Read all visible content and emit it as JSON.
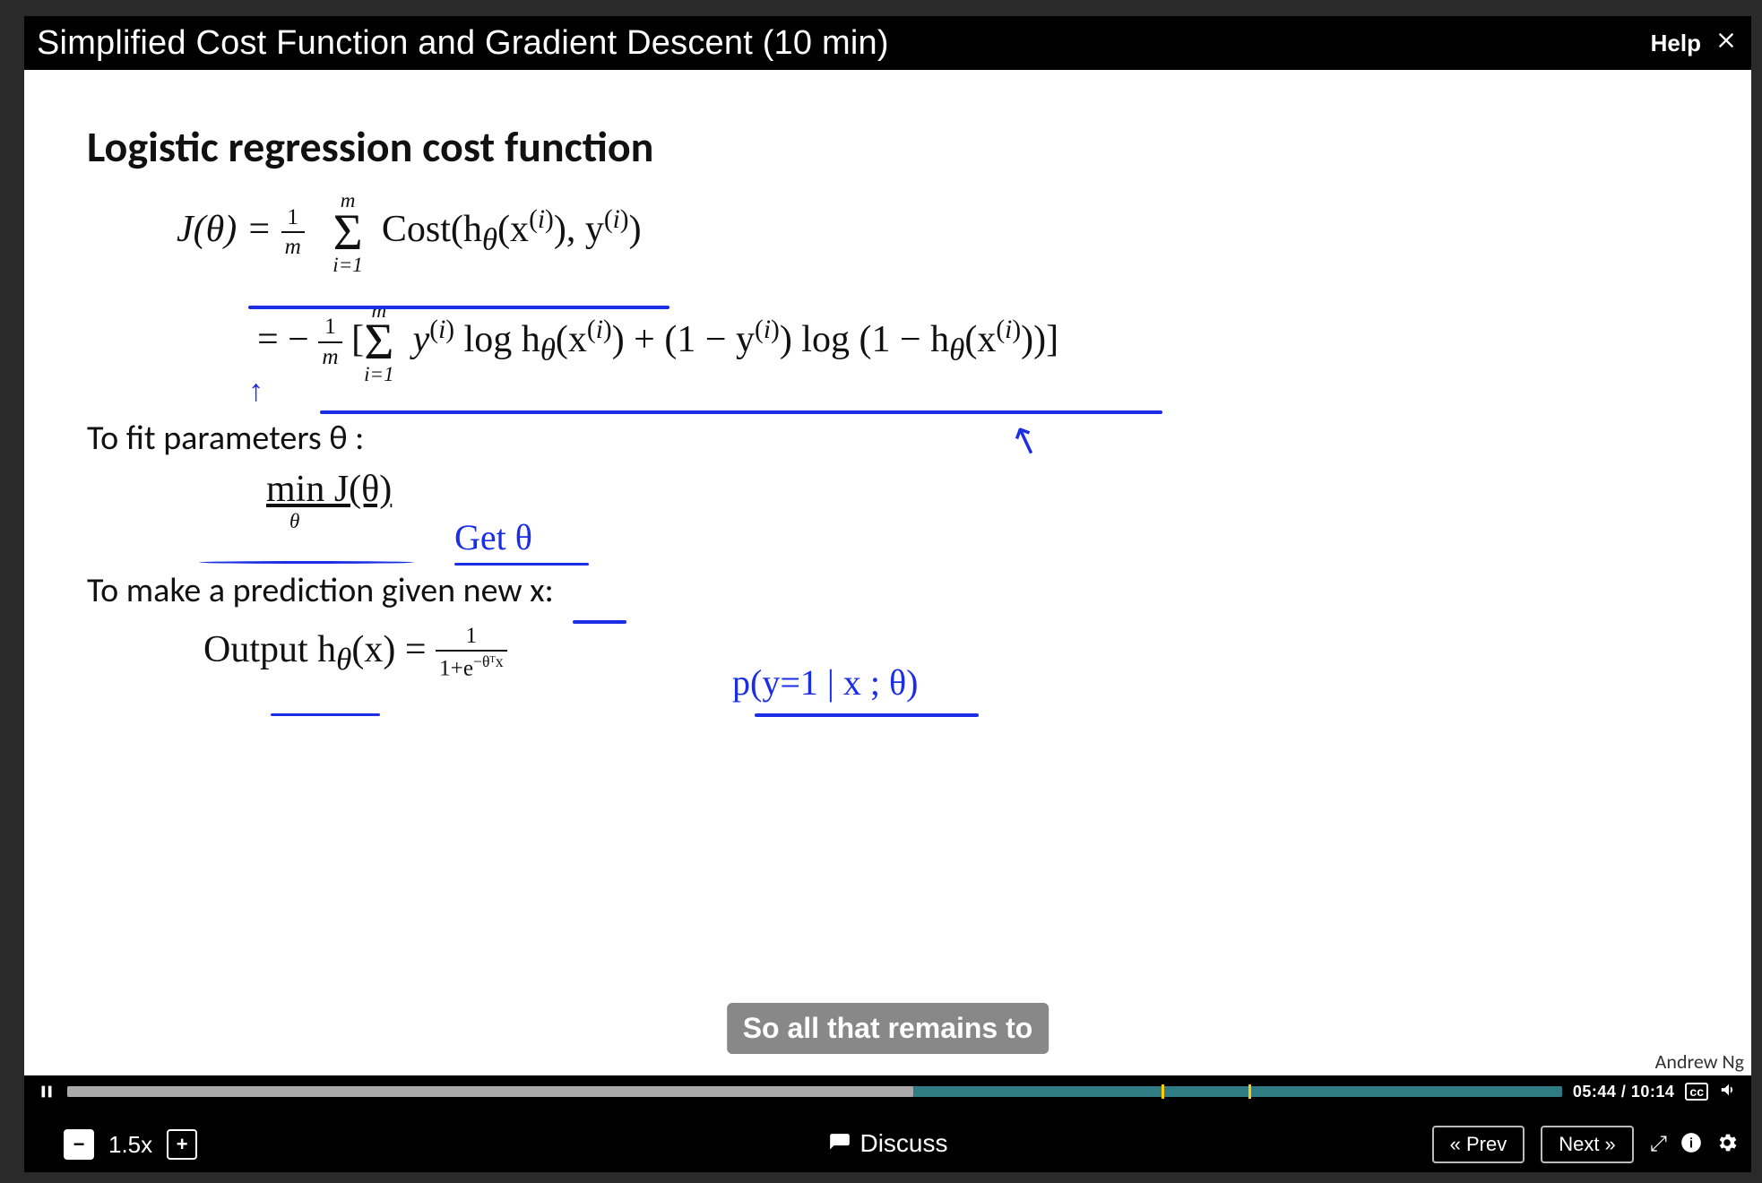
{
  "titlebar": {
    "title": "Simplified Cost Function and Gradient Descent (10 min)",
    "help_label": "Help"
  },
  "slide": {
    "heading": "Logistic regression cost function",
    "eq1_prefix": "J(θ) = ",
    "eq1_cost": "Cost(h",
    "eq1_cost_tail": "(x",
    "eq1_cost_close": "), y",
    "eq1_end": ")",
    "eq2_prefix": "= − ",
    "eq2_a": "y",
    "eq2_b": " log h",
    "eq2_c": "(x",
    "eq2_d": ") + (1 − y",
    "eq2_e": ") log (1 − h",
    "eq2_f": "(x",
    "eq2_g": "))]",
    "fit_text": "To fit parameters θ :",
    "min_text": "min J(θ)",
    "min_sub": "θ",
    "hand_get": "Get θ",
    "hand_prob": "p(y=1 | x ; θ)",
    "predict_text": "To make a prediction given new x:",
    "output_a": "Output  h",
    "output_b": "(x) = ",
    "sig_num": "1",
    "sig_den_a": "1+e",
    "sig_den_exp": "−θᵀx",
    "attribution": "Andrew Ng"
  },
  "caption": "So all that remains to",
  "playback": {
    "played_pct": 56.6,
    "buffered_pct": 100,
    "marks_pct": [
      73.2,
      79.0
    ],
    "time_text": "05:44 / 10:14",
    "cc_label": "cc",
    "speed_label": "1.5x",
    "discuss_label": "Discuss",
    "prev_label": "« Prev",
    "next_label": "Next »"
  }
}
